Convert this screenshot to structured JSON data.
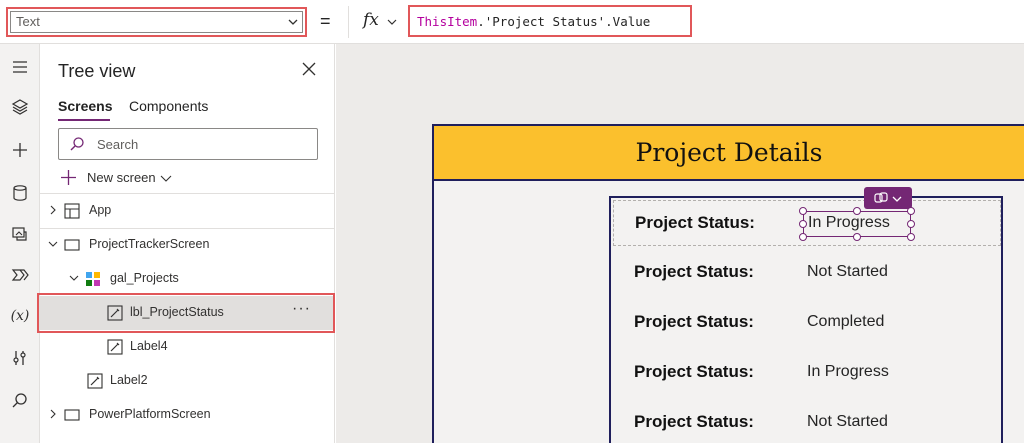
{
  "formula_bar": {
    "property": "Text",
    "equals": "=",
    "fx": "fx",
    "formula_keyword": "ThisItem",
    "formula_rest": ".'Project Status'.Value"
  },
  "rail": {
    "icons": [
      "menu-icon",
      "layers-icon",
      "plus-icon",
      "database-icon",
      "media-icon",
      "power-automate-icon",
      "variables-icon",
      "tools-icon",
      "search-icon"
    ],
    "variables_text": "(x)"
  },
  "tree_view": {
    "title": "Tree view",
    "tabs": [
      {
        "label": "Screens",
        "active": true
      },
      {
        "label": "Components",
        "active": false
      }
    ],
    "search_placeholder": "Search",
    "new_screen_label": "New screen",
    "items": [
      {
        "label": "App",
        "icon": "app-icon"
      },
      {
        "label": "ProjectTrackerScreen",
        "icon": "screen-icon"
      },
      {
        "label": "gal_Projects",
        "icon": "gallery-icon"
      },
      {
        "label": "lbl_ProjectStatus",
        "icon": "label-icon",
        "selected": true
      },
      {
        "label": "Label4",
        "icon": "label-icon"
      },
      {
        "label": "Label2",
        "icon": "label-icon"
      },
      {
        "label": "PowerPlatformScreen",
        "icon": "screen-icon"
      }
    ],
    "more_label": "···"
  },
  "canvas": {
    "header_title": "Project Details",
    "gallery_rows": [
      {
        "key": "Project Status:",
        "value": "In Progress"
      },
      {
        "key": "Project Status:",
        "value": "Not Started"
      },
      {
        "key": "Project Status:",
        "value": "Completed"
      },
      {
        "key": "Project Status:",
        "value": "In Progress"
      },
      {
        "key": "Project Status:",
        "value": "Not Started"
      }
    ]
  },
  "colors": {
    "highlight": "#e15759",
    "accent": "#742774",
    "header": "#fbc02d",
    "border": "#1f1f5c"
  }
}
